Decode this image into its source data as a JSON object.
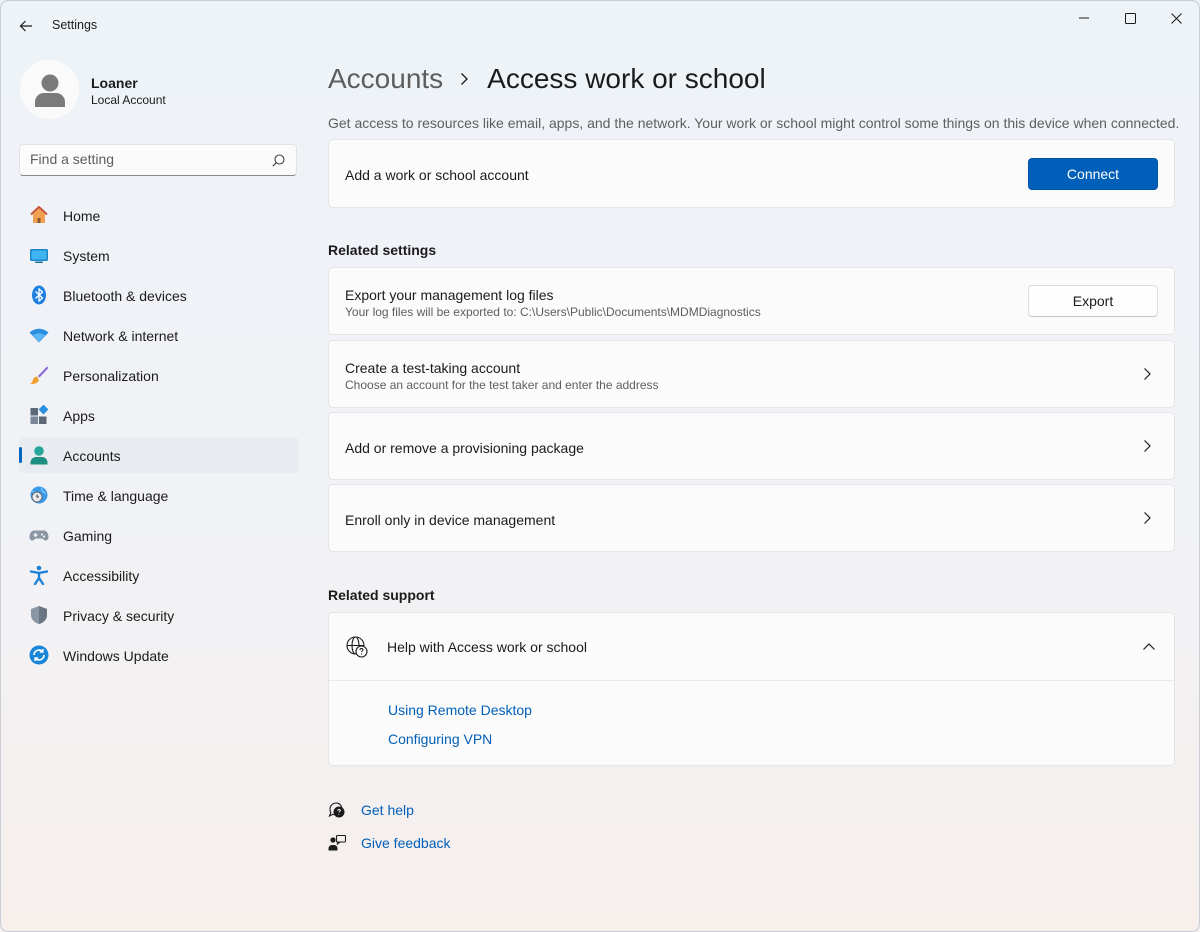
{
  "window": {
    "title": "Settings"
  },
  "profile": {
    "name": "Loaner",
    "type": "Local Account"
  },
  "search": {
    "placeholder": "Find a setting"
  },
  "sidebar": {
    "items": [
      {
        "label": "Home",
        "icon": "home-icon"
      },
      {
        "label": "System",
        "icon": "system-icon"
      },
      {
        "label": "Bluetooth & devices",
        "icon": "bluetooth-icon"
      },
      {
        "label": "Network & internet",
        "icon": "wifi-icon"
      },
      {
        "label": "Personalization",
        "icon": "brush-icon"
      },
      {
        "label": "Apps",
        "icon": "apps-icon"
      },
      {
        "label": "Accounts",
        "icon": "accounts-icon",
        "selected": true
      },
      {
        "label": "Time & language",
        "icon": "clock-globe-icon"
      },
      {
        "label": "Gaming",
        "icon": "gamepad-icon"
      },
      {
        "label": "Accessibility",
        "icon": "accessibility-icon"
      },
      {
        "label": "Privacy & security",
        "icon": "shield-icon"
      },
      {
        "label": "Windows Update",
        "icon": "update-icon"
      }
    ]
  },
  "main": {
    "breadcrumb": {
      "parent": "Accounts",
      "current": "Access work or school"
    },
    "description": "Get access to resources like email, apps, and the network. Your work or school might control some things on this device when connected.",
    "add_account": {
      "label": "Add a work or school account",
      "button": "Connect"
    },
    "related_settings": {
      "header": "Related settings",
      "export": {
        "title": "Export your management log files",
        "subtitle": "Your log files will be exported to: C:\\Users\\Public\\Documents\\MDMDiagnostics",
        "button": "Export"
      },
      "test_account": {
        "title": "Create a test-taking account",
        "subtitle": "Choose an account for the test taker and enter the address"
      },
      "provisioning": {
        "title": "Add or remove a provisioning package"
      },
      "enroll": {
        "title": "Enroll only in device management"
      }
    },
    "related_support": {
      "header": "Related support",
      "help_title": "Help with Access work or school",
      "links": [
        "Using Remote Desktop",
        "Configuring VPN"
      ]
    },
    "footer": {
      "get_help": "Get help",
      "give_feedback": "Give feedback"
    }
  },
  "colors": {
    "accent": "#005fb8",
    "selected_bg": "#e8ebef",
    "link": "#005fb8"
  }
}
